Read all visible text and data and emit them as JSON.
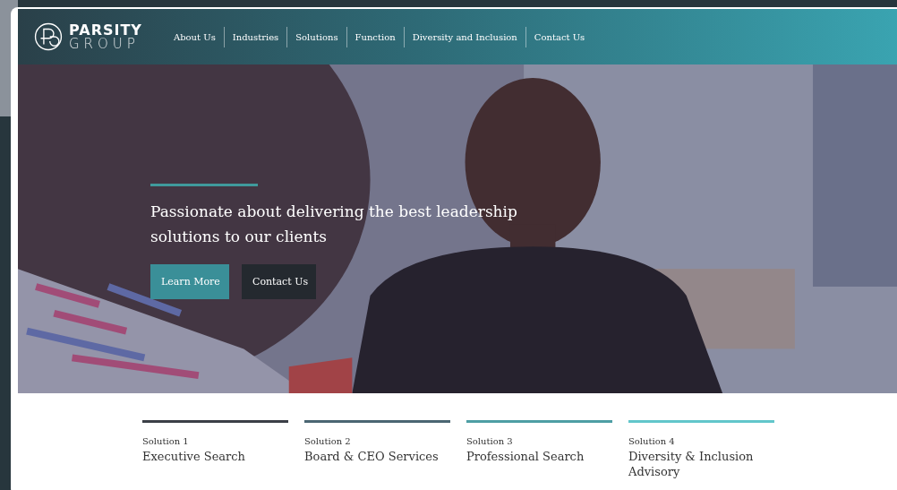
{
  "logo": {
    "line_1": "PARSITY",
    "line_2": "GROUP"
  },
  "nav": [
    {
      "label": "About Us"
    },
    {
      "label": "Industries"
    },
    {
      "label": "Solutions"
    },
    {
      "label": "Function"
    },
    {
      "label": "Diversity and Inclusion"
    },
    {
      "label": "Contact Us"
    }
  ],
  "hero": {
    "kind": "picture",
    "headline": "Passionate about delivering the best leadership solutions to our clients",
    "buttons": [
      {
        "label": "Learn More",
        "kind": "primary"
      },
      {
        "label": "Contact Us",
        "kind": "dark"
      }
    ]
  },
  "solutions": [
    {
      "label": "Solution 1",
      "title": "Executive Search",
      "color": "#3b3f47"
    },
    {
      "label": "Solution 2",
      "title": "Board & CEO Services",
      "color": "#4b6672"
    },
    {
      "label": "Solution 3",
      "title": "Professional Search",
      "color": "#4e9ea4"
    },
    {
      "label": "Solution 4",
      "title": "Diversity & Inclusion Advisory",
      "color": "#62c6cb"
    }
  ]
}
